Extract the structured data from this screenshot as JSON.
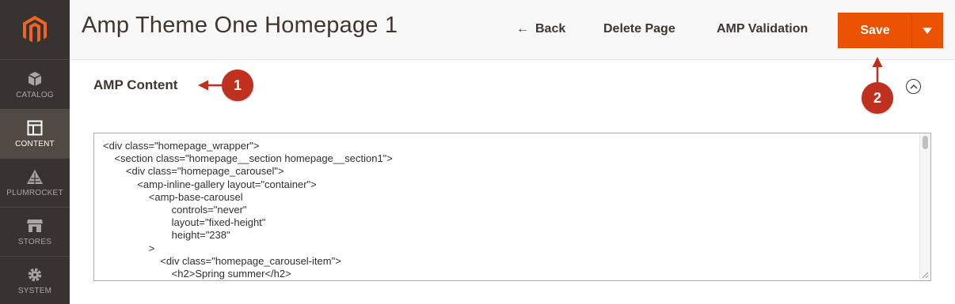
{
  "sidebar": {
    "logo": "magento-logo",
    "items": [
      {
        "label": "CATALOG",
        "icon": "cube-icon"
      },
      {
        "label": "CONTENT",
        "icon": "layout-icon",
        "active": true
      },
      {
        "label": "PLUMROCKET",
        "icon": "plumrocket-icon"
      },
      {
        "label": "STORES",
        "icon": "store-icon"
      },
      {
        "label": "SYSTEM",
        "icon": "gear-icon"
      }
    ]
  },
  "header": {
    "title": "Amp Theme One Homepage 1",
    "back_label": "Back",
    "delete_label": "Delete Page",
    "amp_validation_label": "AMP Validation",
    "save_label": "Save"
  },
  "section": {
    "title": "AMP Content"
  },
  "editor": {
    "lines": [
      "<div class=\"homepage_wrapper\">",
      "    <section class=\"homepage__section homepage__section1\">",
      "        <div class=\"homepage_carousel\">",
      "            <amp-inline-gallery layout=\"container\">",
      "                <amp-base-carousel",
      "                        controls=\"never\"",
      "                        layout=\"fixed-height\"",
      "                        height=\"238\"",
      "                >",
      "                    <div class=\"homepage_carousel-item\">",
      "                        <h2>Spring summer</h2>"
    ]
  },
  "annotations": {
    "marker1": "1",
    "marker2": "2"
  },
  "colors": {
    "sidebar_bg": "#373330",
    "sidebar_active": "#514943",
    "accent": "#eb5202",
    "marker": "#c0301f",
    "text": "#41362f"
  }
}
